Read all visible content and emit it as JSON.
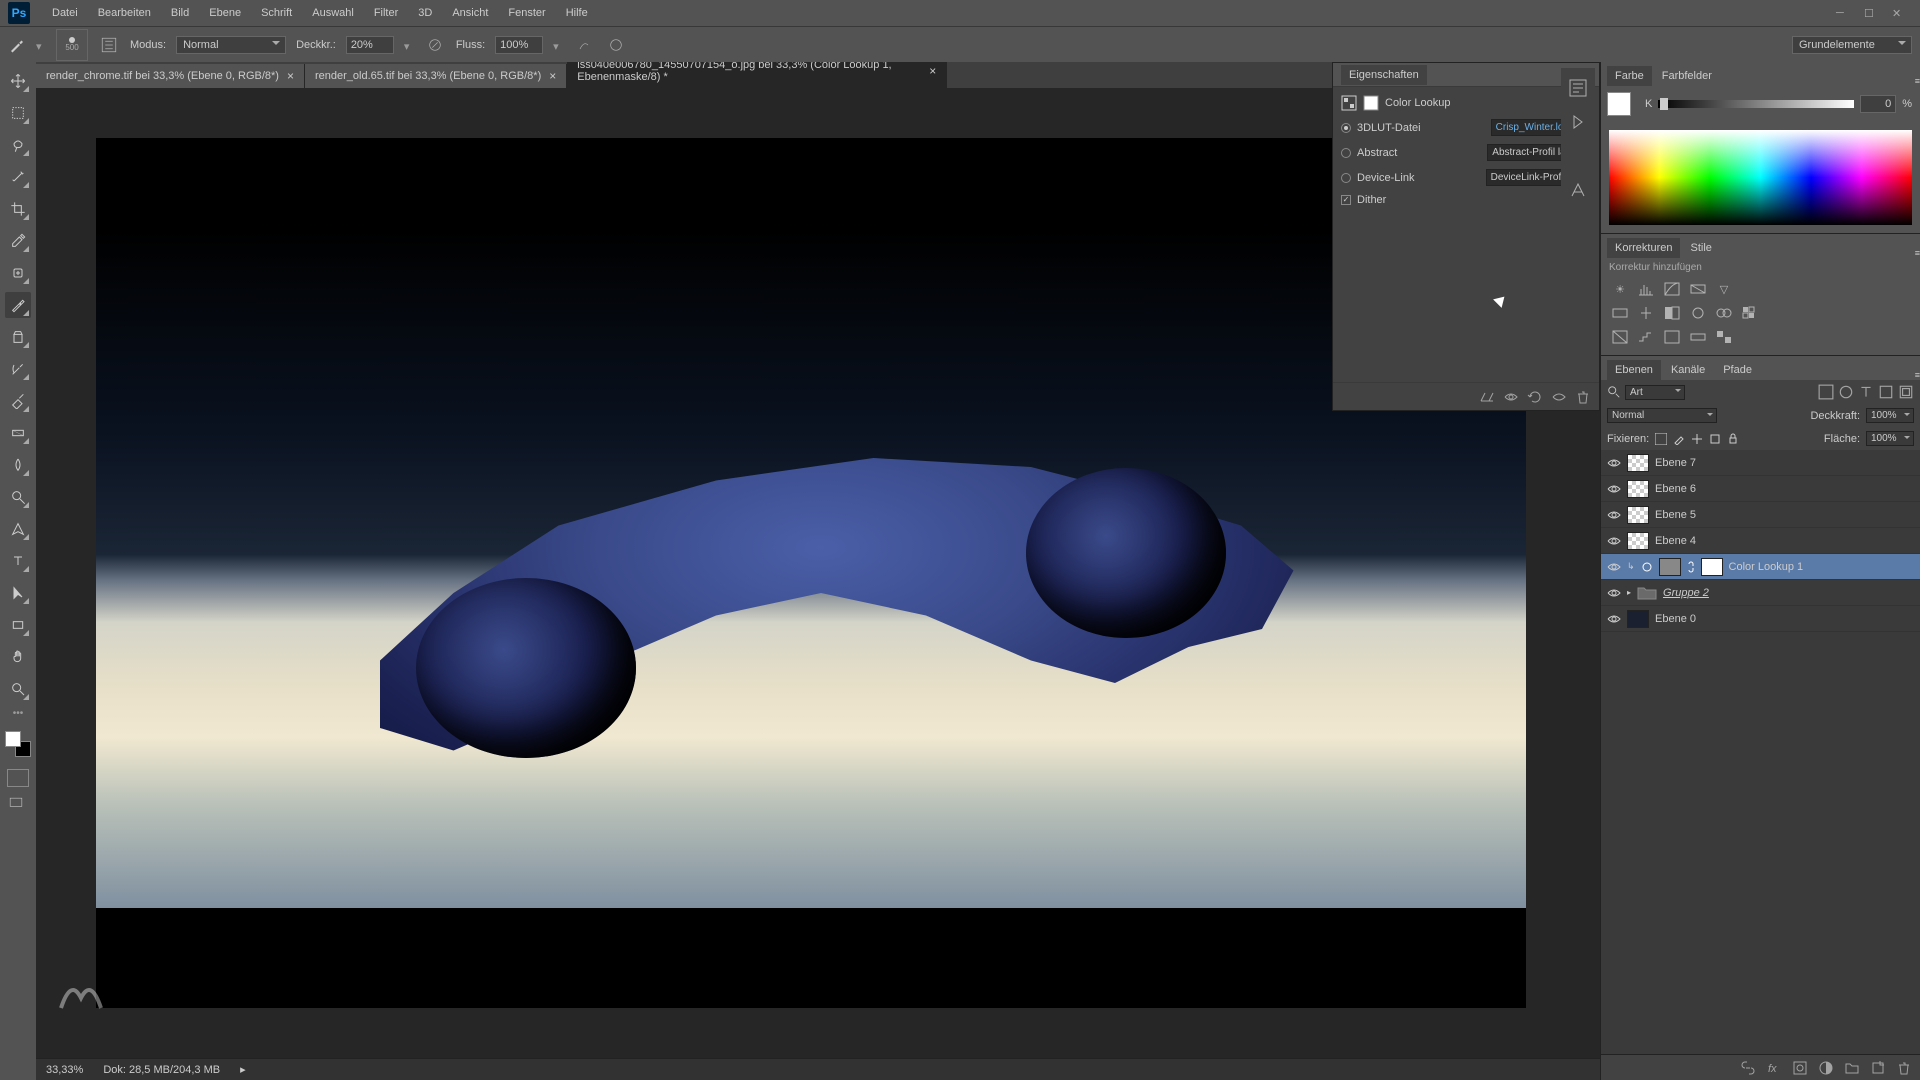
{
  "menubar": {
    "items": [
      "Datei",
      "Bearbeiten",
      "Bild",
      "Ebene",
      "Schrift",
      "Auswahl",
      "Filter",
      "3D",
      "Ansicht",
      "Fenster",
      "Hilfe"
    ]
  },
  "options": {
    "brush_size": "500",
    "mode_label": "Modus:",
    "mode_value": "Normal",
    "opacity_label": "Deckkr.:",
    "opacity_value": "20%",
    "flow_label": "Fluss:",
    "flow_value": "100%",
    "workspace": "Grundelemente"
  },
  "tabs": [
    {
      "label": "render_chrome.tif bei 33,3% (Ebene 0, RGB/8*)",
      "active": false
    },
    {
      "label": "render_old.65.tif bei 33,3% (Ebene 0, RGB/8*)",
      "active": false
    },
    {
      "label": "iss040e006780_14550707154_o.jpg bei 33,3%  (Color Lookup 1, Ebenenmaske/8) *",
      "active": true
    }
  ],
  "properties": {
    "title": "Eigenschaften",
    "adjustment_type": "Color Lookup",
    "rows": [
      {
        "type": "radio",
        "checked": true,
        "label": "3DLUT-Datei",
        "value": "Crisp_Winter.look",
        "highlight": true
      },
      {
        "type": "radio",
        "checked": false,
        "label": "Abstract",
        "value": "Abstract-Profil la...",
        "highlight": false
      },
      {
        "type": "radio",
        "checked": false,
        "label": "Device-Link",
        "value": "DeviceLink-Profil...",
        "highlight": false
      }
    ],
    "dither_label": "Dither"
  },
  "color_panel": {
    "tab1": "Farbe",
    "tab2": "Farbfelder",
    "k_label": "K",
    "value": "0",
    "unit": "%"
  },
  "adjustments": {
    "tab1": "Korrekturen",
    "tab2": "Stile",
    "add_label": "Korrektur hinzufügen"
  },
  "layers": {
    "tab1": "Ebenen",
    "tab2": "Kanäle",
    "tab3": "Pfade",
    "filter_kind": "Art",
    "blend_mode": "Normal",
    "opacity_label": "Deckkraft:",
    "opacity_value": "100%",
    "lock_label": "Fixieren:",
    "fill_label": "Fläche:",
    "fill_value": "100%",
    "items": [
      {
        "name": "Ebene 7",
        "type": "pixel"
      },
      {
        "name": "Ebene 6",
        "type": "pixel"
      },
      {
        "name": "Ebene 5",
        "type": "pixel"
      },
      {
        "name": "Ebene 4",
        "type": "pixel"
      },
      {
        "name": "Color Lookup 1",
        "type": "adjustment",
        "selected": true
      },
      {
        "name": "Gruppe 2",
        "type": "group"
      },
      {
        "name": "Ebene 0",
        "type": "pixel-dark"
      }
    ]
  },
  "status": {
    "zoom": "33,33%",
    "doc": "Dok: 28,5 MB/204,3 MB"
  }
}
